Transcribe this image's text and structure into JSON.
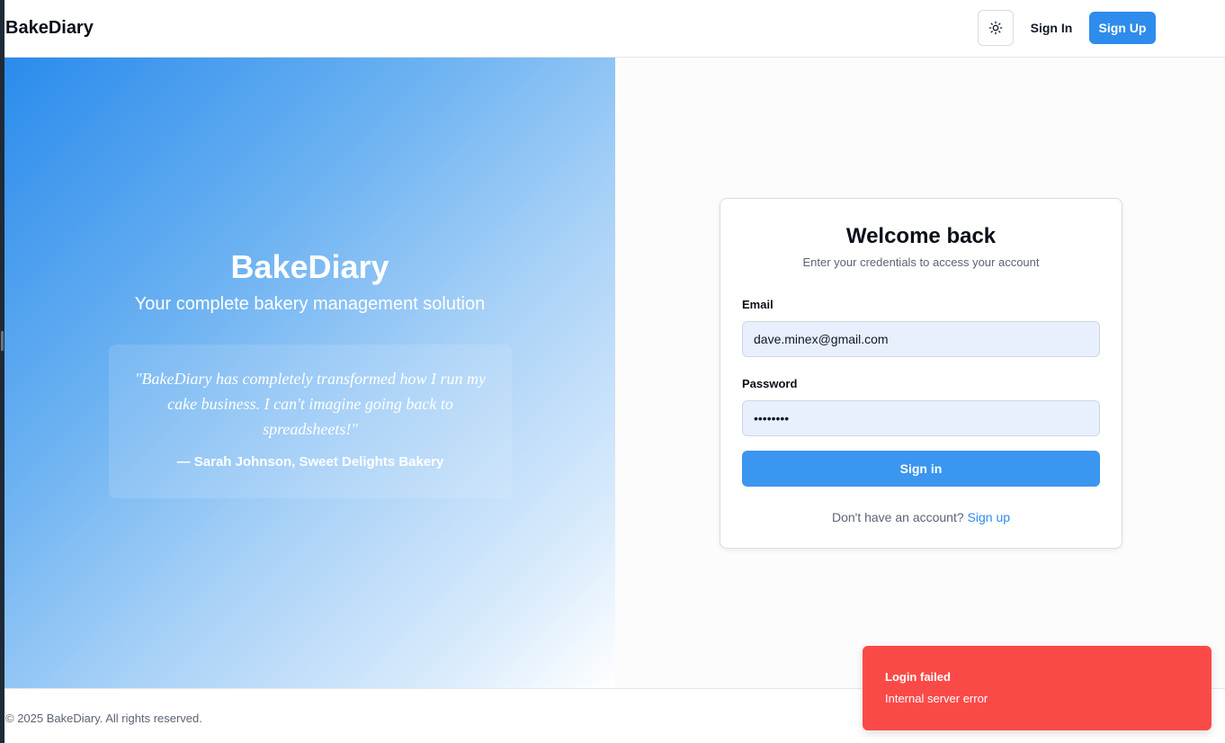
{
  "navbar": {
    "brand": "BakeDiary",
    "theme_icon": "sun-icon",
    "signin_label": "Sign In",
    "signup_label": "Sign Up"
  },
  "hero": {
    "title": "BakeDiary",
    "subtitle": "Your complete bakery management solution",
    "quote": "\"BakeDiary has completely transformed how I run my cake business. I can't imagine going back to spreadsheets!\"",
    "author": "— Sarah Johnson, Sweet Delights Bakery"
  },
  "login": {
    "title": "Welcome back",
    "description": "Enter your credentials to access your account",
    "email_label": "Email",
    "email_value": "dave.minex@gmail.com",
    "password_label": "Password",
    "password_value": "password",
    "submit_label": "Sign in",
    "signup_prompt": "Don't have an account?",
    "signup_link": "Sign up"
  },
  "footer": {
    "copyright": "© 2025 BakeDiary. All rights reserved."
  },
  "toast": {
    "title": "Login failed",
    "message": "Internal server error"
  },
  "colors": {
    "primary": "#2d8cec",
    "toast_error": "#fa4a48",
    "input_fill": "#e8f0fe"
  }
}
